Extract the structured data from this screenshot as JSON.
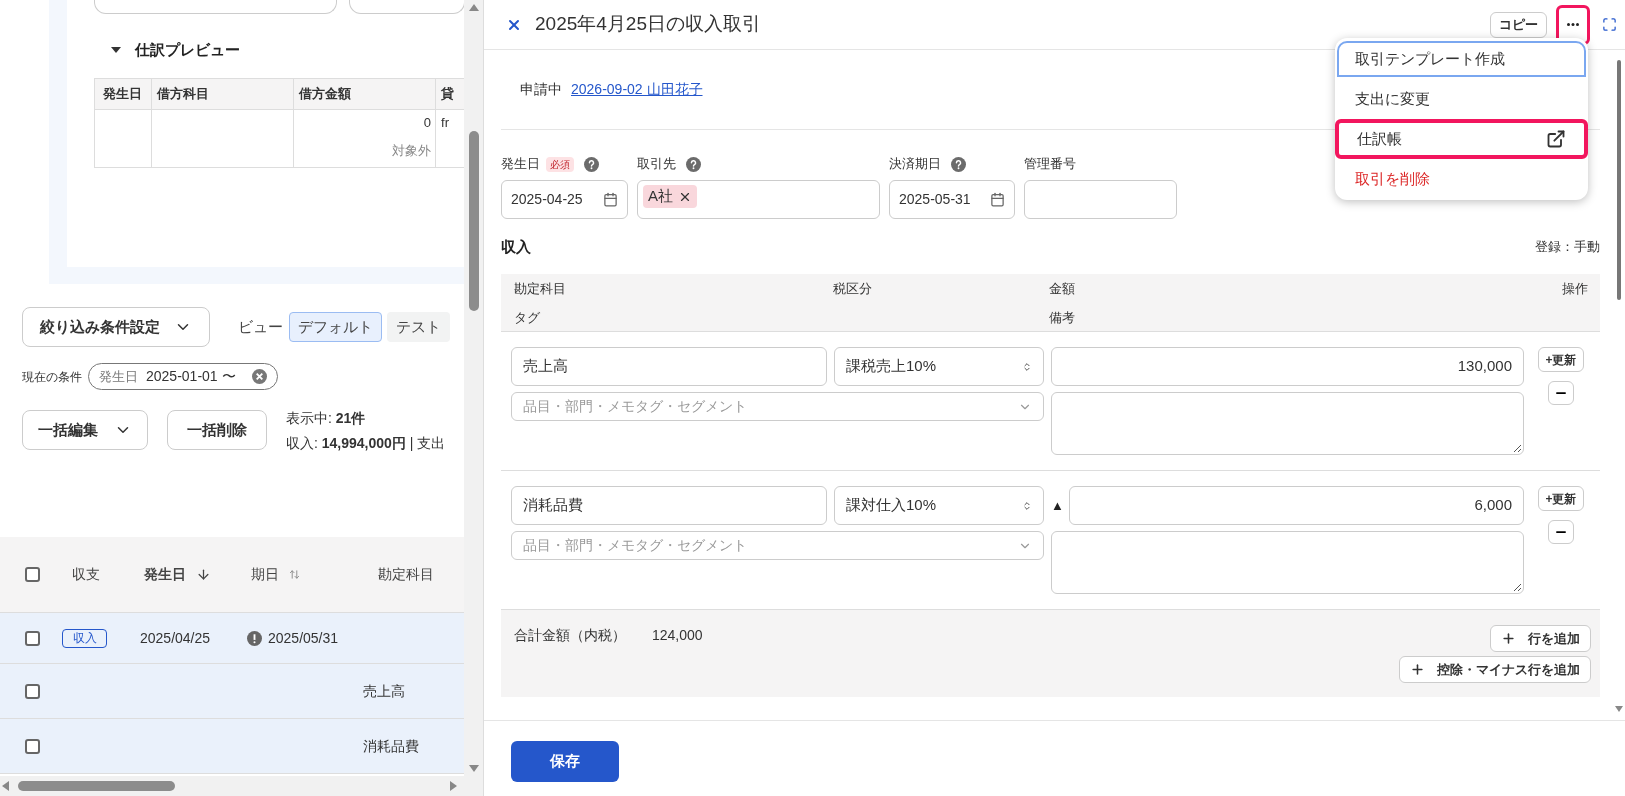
{
  "left_panel": {
    "preview": {
      "title": "仕訳プレビュー",
      "expanded": true,
      "columns": [
        "発生日",
        "借方科目",
        "借方金額",
        "貸"
      ],
      "debit_amount": "0",
      "debit_note": "対象外",
      "credit_partial": "fr"
    },
    "filter_button": "絞り込み条件設定",
    "view_label": "ビュー",
    "view_tabs": [
      {
        "label": "デフォルト",
        "selected": true
      },
      {
        "label": "テスト",
        "selected": false
      }
    ],
    "conditions": {
      "label": "現在の条件",
      "chips": [
        {
          "field": "発生日",
          "value": "2025-01-01 〜"
        }
      ]
    },
    "bulk_edit": "一括編集",
    "bulk_delete": "一括削除",
    "summary": [
      "表示中: **21件**",
      "収入: **14,994,000円** | 支出"
    ],
    "table": {
      "all_checked": false,
      "columns": [
        {
          "label": "収支",
          "sortable": false,
          "sorted": false
        },
        {
          "label": "発生日",
          "sortable": true,
          "sorted": true
        },
        {
          "label": "期日",
          "sortable": true,
          "sorted": false
        },
        {
          "label": "勘定科目",
          "sortable": false,
          "sorted": false
        }
      ],
      "rows": [
        {
          "kind": "transaction",
          "checked": false,
          "selected": true,
          "badge": "収入",
          "date": "2025/04/25",
          "due": "2025/05/31",
          "due_warning": true
        },
        {
          "kind": "line",
          "checked": false,
          "selected": true,
          "account": "売上高"
        },
        {
          "kind": "line",
          "checked": false,
          "selected": true,
          "account": "消耗品費"
        }
      ]
    }
  },
  "detail": {
    "title": "2025年4月25日の収入取引",
    "copy_button": "コピー",
    "more_highlighted": true,
    "status": {
      "label": "申請中",
      "link": "2026-09-02 山田花子"
    },
    "fields": [
      {
        "kind": "date",
        "label": "発生日",
        "required": "必須",
        "help": true,
        "value": "2025-04-25"
      },
      {
        "kind": "tags",
        "label": "取引先",
        "help": true,
        "tags": [
          "A社"
        ]
      },
      {
        "kind": "date",
        "label": "決済期日",
        "help": true,
        "value": "2025-05-31"
      },
      {
        "kind": "text",
        "label": "管理番号"
      }
    ],
    "section_title": "収入",
    "registration": "登録：手動",
    "lines": {
      "columns": [
        "勘定科目",
        "税区分",
        "金額",
        "操作"
      ],
      "sub_columns": [
        "タグ",
        "備考"
      ],
      "rows": [
        {
          "account": "売上高",
          "tax": "課税売上10%",
          "amount": "130,000",
          "tag_placeholder": "品目・部門・メモタグ・セグメント",
          "update_button": "+更新"
        },
        {
          "account": "消耗品費",
          "tax": "課対仕入10%",
          "sign": "▲",
          "amount": "6,000",
          "tag_placeholder": "品目・部門・メモタグ・セグメント",
          "update_button": "+更新"
        }
      ]
    },
    "total": {
      "label": "合計金額（内税）",
      "value": "124,000"
    },
    "add_buttons": [
      "行を追加",
      "控除・マイナス行を追加"
    ],
    "save_button": "保存",
    "menu": {
      "items": [
        {
          "kind": "normal",
          "label": "取引テンプレート作成",
          "focused": true,
          "highlighted": false,
          "external": false
        },
        {
          "kind": "normal",
          "label": "支出に変更",
          "focused": false,
          "highlighted": false,
          "external": false
        },
        {
          "kind": "normal",
          "label": "仕訳帳",
          "focused": false,
          "highlighted": true,
          "external": true
        },
        {
          "kind": "danger",
          "label": "取引を削除",
          "focused": false,
          "highlighted": false,
          "external": false
        }
      ]
    }
  }
}
